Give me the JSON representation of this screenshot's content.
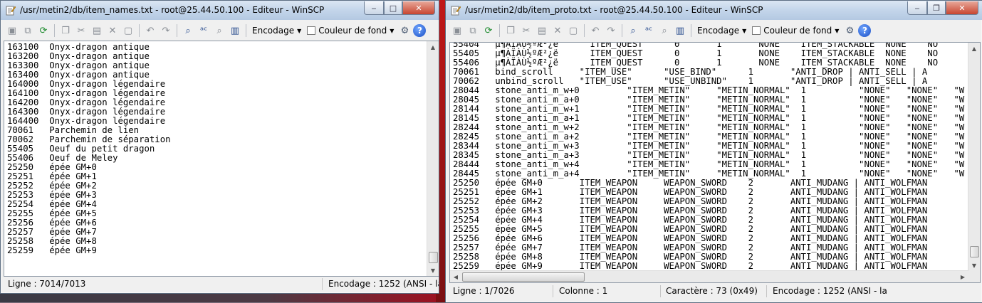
{
  "left_window": {
    "title": "/usr/metin2/db/item_names.txt - root@25.44.50.100 - Editeur - WinSCP",
    "toolbar": {
      "encoding_label": "Encodage",
      "background_label": "Couleur de fond"
    },
    "lines": [
      "163100  Onyx-dragon antique",
      "163200  Onyx-dragon antique",
      "163300  Onyx-dragon antique",
      "163400  Onyx-dragon antique",
      "164000  Onyx-dragon légendaire",
      "164100  Onyx-dragon légendaire",
      "164200  Onyx-dragon légendaire",
      "164300  Onyx-dragon légendaire",
      "164400  Onyx-dragon légendaire",
      "70061   Parchemin de lien",
      "70062   Parchemin de séparation",
      "55405   Oeuf du petit dragon",
      "55406   Oeuf de Meley",
      "25250   épée GM+0",
      "25251   épée GM+1",
      "25252   épée GM+2",
      "25253   épée GM+3",
      "25254   épée GM+4",
      "25255   épée GM+5",
      "25256   épée GM+6",
      "25257   épée GM+7",
      "25258   épée GM+8",
      "25259   épée GM+9"
    ],
    "status": {
      "line": "Ligne : 7014/7013",
      "encoding": "Encodage : 1252  (ANSI - la"
    }
  },
  "right_window": {
    "title": "/usr/metin2/db/item_proto.txt - root@25.44.50.100 - Editeur - WinSCP",
    "toolbar": {
      "encoding_label": "Encodage",
      "background_label": "Couleur de fond"
    },
    "lines": [
      "55404   µ¶ÀÏÀÙ½ºÆ²¿ë      ITEM_QUEST      0       1       NONE    ITEM_STACKABLE  NONE    NO",
      "55405   µ¶ÀÏÀÙ½ºÆ²¿ë      ITEM_QUEST      0       1       NONE    ITEM_STACKABLE  NONE    NO",
      "55406   µ¶ÀÏÀÙ½ºÆ²¿ë      ITEM_QUEST      0       1       NONE    ITEM_STACKABLE  NONE    NO",
      "70061   bind_scroll     \"ITEM_USE\"      \"USE_BIND\"      1       \"ANTI_DROP | ANTI_SELL | A",
      "70062   unbind_scroll   \"ITEM_USE\"      \"USE_UNBIND\"    1       \"ANTI_DROP | ANTI_SELL | A",
      "28044   stone_anti_m_w+0         \"ITEM_METIN\"     \"METIN_NORMAL\"  1          \"NONE\"   \"NONE\"   \"W",
      "28045   stone_anti_m_a+0         \"ITEM_METIN\"     \"METIN_NORMAL\"  1          \"NONE\"   \"NONE\"   \"W",
      "28144   stone_anti_m_w+1         \"ITEM_METIN\"     \"METIN_NORMAL\"  1          \"NONE\"   \"NONE\"   \"W",
      "28145   stone_anti_m_a+1         \"ITEM_METIN\"     \"METIN_NORMAL\"  1          \"NONE\"   \"NONE\"   \"W",
      "28244   stone_anti_m_w+2         \"ITEM_METIN\"     \"METIN_NORMAL\"  1          \"NONE\"   \"NONE\"   \"W",
      "28245   stone_anti_m_a+2         \"ITEM_METIN\"     \"METIN_NORMAL\"  1          \"NONE\"   \"NONE\"   \"W",
      "28344   stone_anti_m_w+3         \"ITEM_METIN\"     \"METIN_NORMAL\"  1          \"NONE\"   \"NONE\"   \"W",
      "28345   stone_anti_m_a+3         \"ITEM_METIN\"     \"METIN_NORMAL\"  1          \"NONE\"   \"NONE\"   \"W",
      "28444   stone_anti_m_w+4         \"ITEM_METIN\"     \"METIN_NORMAL\"  1          \"NONE\"   \"NONE\"   \"W",
      "28445   stone_anti_m_a+4         \"ITEM_METIN\"     \"METIN_NORMAL\"  1          \"NONE\"   \"NONE\"   \"W",
      "25250   épée GM+0       ITEM_WEAPON     WEAPON_SWORD    2       ANTI_MUDANG | ANTI_WOLFMAN",
      "25251   épée GM+1       ITEM_WEAPON     WEAPON_SWORD    2       ANTI_MUDANG | ANTI_WOLFMAN",
      "25252   épée GM+2       ITEM_WEAPON     WEAPON_SWORD    2       ANTI_MUDANG | ANTI_WOLFMAN",
      "25253   épée GM+3       ITEM_WEAPON     WEAPON_SWORD    2       ANTI_MUDANG | ANTI_WOLFMAN",
      "25254   épée GM+4       ITEM_WEAPON     WEAPON_SWORD    2       ANTI_MUDANG | ANTI_WOLFMAN",
      "25255   épée GM+5       ITEM_WEAPON     WEAPON_SWORD    2       ANTI_MUDANG | ANTI_WOLFMAN",
      "25256   épée GM+6       ITEM_WEAPON     WEAPON_SWORD    2       ANTI_MUDANG | ANTI_WOLFMAN",
      "25257   épée GM+7       ITEM_WEAPON     WEAPON_SWORD    2       ANTI_MUDANG | ANTI_WOLFMAN",
      "25258   épée GM+8       ITEM_WEAPON     WEAPON_SWORD    2       ANTI_MUDANG | ANTI_WOLFMAN",
      "25259   épée GM+9       ITEM_WEAPON     WEAPON_SWORD    2       ANTI_MUDANG | ANTI_WOLFMAN"
    ],
    "status": {
      "line": "Ligne : 1/7026",
      "column": "Colonne : 1",
      "character": "Caractère : 73 (0x49)",
      "encoding": "Encodage : 1252  (ANSI - la"
    }
  },
  "icons": [
    "notepad-icon",
    "save-icon",
    "save-all-icon",
    "refresh-icon",
    "copy-icon",
    "cut-icon",
    "paste-icon",
    "delete-icon",
    "select-all-icon",
    "undo-icon",
    "redo-icon",
    "find-icon",
    "replace-icon",
    "find-next-icon",
    "goto-line-icon",
    "settings-icon",
    "help-icon"
  ]
}
